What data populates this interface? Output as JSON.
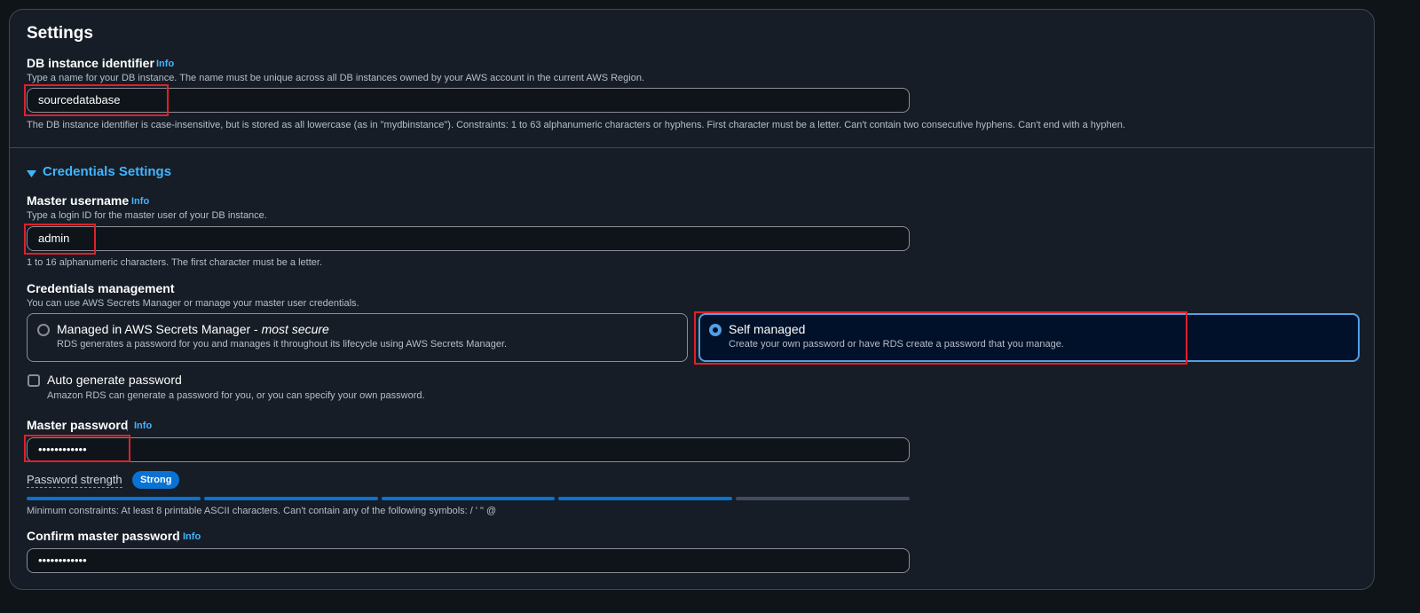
{
  "settings": {
    "title": "Settings",
    "db_identifier": {
      "label": "DB instance identifier",
      "info": "Info",
      "description": "Type a name for your DB instance. The name must be unique across all DB instances owned by your AWS account in the current AWS Region.",
      "value": "sourcedatabase",
      "constraint": "The DB instance identifier is case-insensitive, but is stored as all lowercase (as in \"mydbinstance\"). Constraints: 1 to 63 alphanumeric characters or hyphens. First character must be a letter. Can't contain two consecutive hyphens. Can't end with a hyphen."
    }
  },
  "credentials": {
    "title": "Credentials Settings",
    "master_username": {
      "label": "Master username",
      "info": "Info",
      "description": "Type a login ID for the master user of your DB instance.",
      "value": "admin",
      "constraint": "1 to 16 alphanumeric characters. The first character must be a letter."
    },
    "management": {
      "label": "Credentials management",
      "description": "You can use AWS Secrets Manager or manage your master user credentials.",
      "options": [
        {
          "title": "Managed in AWS Secrets Manager - ",
          "title_em": "most secure",
          "description": "RDS generates a password for you and manages it throughout its lifecycle using AWS Secrets Manager.",
          "selected": false
        },
        {
          "title": "Self managed",
          "title_em": "",
          "description": "Create your own password or have RDS create a password that you manage.",
          "selected": true
        }
      ]
    },
    "auto_generate": {
      "label": "Auto generate password",
      "description": "Amazon RDS can generate a password for you, or you can specify your own password.",
      "checked": false
    },
    "master_password": {
      "label": "Master password",
      "info": "Info",
      "value": "••••••••••••",
      "strength_label": "Password strength",
      "strength_value": "Strong",
      "strength_fraction": 0.8,
      "constraint": "Minimum constraints: At least 8 printable ASCII characters. Can't contain any of the following symbols: / ' \" @"
    },
    "confirm_password": {
      "label": "Confirm master password",
      "info": "Info",
      "value": "••••••••••••"
    }
  },
  "colors": {
    "accent": "#42b4ff",
    "selected_border": "#539fe5",
    "strength_fill": "#0972d3",
    "highlight": "#e0202a"
  }
}
